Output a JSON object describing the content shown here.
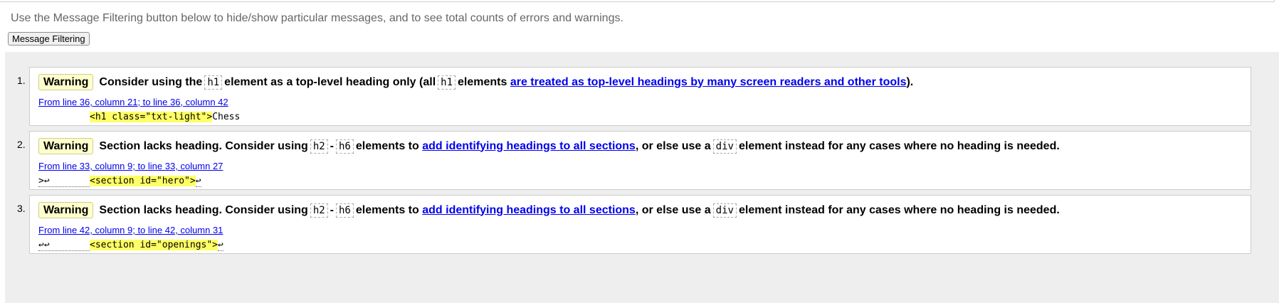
{
  "intro_text": "Use the Message Filtering button below to hide/show particular messages, and to see total counts of errors and warnings.",
  "filter_button": "Message Filtering",
  "messages": [
    {
      "number": "1.",
      "badge": "Warning",
      "t1": "Consider using the",
      "c1": "h1",
      "t2": "element as a top-level heading only (all",
      "c2": "h1",
      "t3": "elements",
      "link": "are treated as top-level headings by many screen readers and other tools",
      "t4": ").",
      "location": "From line 36, column 21; to line 36, column 42",
      "extract_before": "",
      "extract_highlight": "<h1 class=\"txt-light\">",
      "extract_after": "Chess"
    },
    {
      "number": "2.",
      "badge": "Warning",
      "t1": "Section lacks heading. Consider using",
      "c1": "h2",
      "dash": "-",
      "c2": "h6",
      "t2": "elements to",
      "link": "add identifying headings to all sections",
      "t3": ", or else use a",
      "c3": "div",
      "t4": "element instead for any cases where no heading is needed.",
      "location": "From line 33, column 9; to line 33, column 27",
      "extract_before": ">↩",
      "extract_highlight": "<section id=\"hero\">",
      "extract_after": "↩"
    },
    {
      "number": "3.",
      "badge": "Warning",
      "t1": "Section lacks heading. Consider using",
      "c1": "h2",
      "dash": "-",
      "c2": "h6",
      "t2": "elements to",
      "link": "add identifying headings to all sections",
      "t3": ", or else use a",
      "c3": "div",
      "t4": "element instead for any cases where no heading is needed.",
      "location": "From line 42, column 9; to line 42, column 31",
      "extract_before": "↩↩",
      "extract_highlight": "<section id=\"openings\">",
      "extract_after": "↩"
    }
  ]
}
